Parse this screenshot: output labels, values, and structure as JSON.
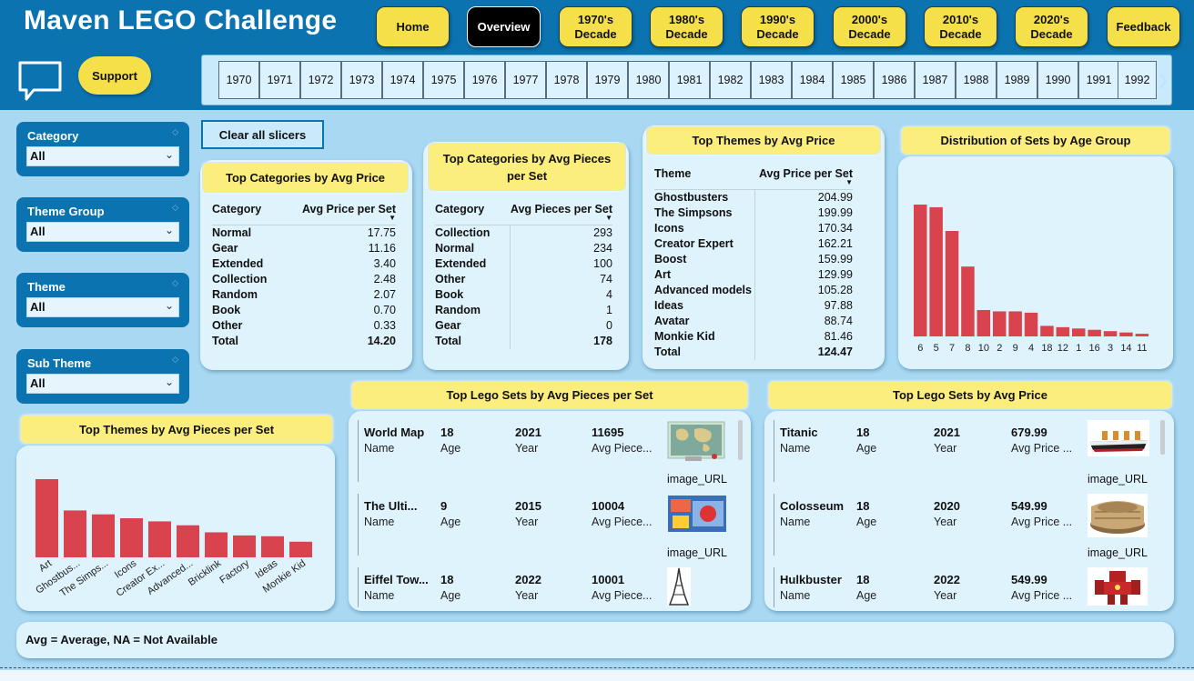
{
  "header": {
    "title": "Maven LEGO Challenge",
    "nav": [
      {
        "label": "Home",
        "active": false
      },
      {
        "label": "Overview",
        "active": true
      },
      {
        "label": "1970's Decade",
        "active": false
      },
      {
        "label": "1980's Decade",
        "active": false
      },
      {
        "label": "1990's Decade",
        "active": false
      },
      {
        "label": "2000's Decade",
        "active": false
      },
      {
        "label": "2010's Decade",
        "active": false
      },
      {
        "label": "2020's Decade",
        "active": false
      },
      {
        "label": "Feedback",
        "active": false
      }
    ],
    "support_label": "Support",
    "years": [
      "1970",
      "1971",
      "1972",
      "1973",
      "1974",
      "1975",
      "1976",
      "1977",
      "1978",
      "1979",
      "1980",
      "1981",
      "1982",
      "1983",
      "1984",
      "1985",
      "1986",
      "1987",
      "1988",
      "1989",
      "1990",
      "1991",
      "1992"
    ]
  },
  "slicers": [
    {
      "label": "Category",
      "value": "All"
    },
    {
      "label": "Theme Group",
      "value": "All"
    },
    {
      "label": "Theme",
      "value": "All"
    },
    {
      "label": "Sub Theme",
      "value": "All"
    }
  ],
  "clear_label": "Clear all slicers",
  "top_categories_price": {
    "title": "Top Categories by Avg Price",
    "col1": "Category",
    "col2": "Avg Price per Set",
    "rows": [
      [
        "Normal",
        "17.75"
      ],
      [
        "Gear",
        "11.16"
      ],
      [
        "Extended",
        "3.40"
      ],
      [
        "Collection",
        "2.48"
      ],
      [
        "Random",
        "2.07"
      ],
      [
        "Book",
        "0.70"
      ],
      [
        "Other",
        "0.33"
      ]
    ],
    "total_label": "Total",
    "total": "14.20"
  },
  "top_categories_pieces": {
    "title": "Top Categories by Avg Pieces per Set",
    "col1": "Category",
    "col2": "Avg Pieces per Set",
    "rows": [
      [
        "Collection",
        "293"
      ],
      [
        "Normal",
        "234"
      ],
      [
        "Extended",
        "100"
      ],
      [
        "Other",
        "74"
      ],
      [
        "Book",
        "4"
      ],
      [
        "Random",
        "1"
      ],
      [
        "Gear",
        "0"
      ]
    ],
    "total_label": "Total",
    "total": "178"
  },
  "top_themes_price": {
    "title": "Top Themes by Avg Price",
    "col1": "Theme",
    "col2": "Avg Price per Set",
    "rows": [
      [
        "Ghostbusters",
        "204.99"
      ],
      [
        "The Simpsons",
        "199.99"
      ],
      [
        "Icons",
        "170.34"
      ],
      [
        "Creator Expert",
        "162.21"
      ],
      [
        "Boost",
        "159.99"
      ],
      [
        "Art",
        "129.99"
      ],
      [
        "Advanced models",
        "105.28"
      ],
      [
        "Ideas",
        "97.88"
      ],
      [
        "Avatar",
        "88.74"
      ],
      [
        "Monkie Kid",
        "81.46"
      ]
    ],
    "total_label": "Total",
    "total": "124.47"
  },
  "age_distribution_title": "Distribution of Sets by Age Group",
  "themes_pieces_title": "Top Themes by Avg Pieces per Set",
  "sets_by_pieces": {
    "title": "Top Lego Sets by Avg Pieces per Set",
    "rows": [
      {
        "name": "World Map",
        "age": "18",
        "year": "2021",
        "metric": "11695"
      },
      {
        "name": "The Ulti...",
        "age": "9",
        "year": "2015",
        "metric": "10004"
      },
      {
        "name": "Eiffel Tow...",
        "age": "18",
        "year": "2022",
        "metric": "10001"
      }
    ],
    "labels": {
      "name": "Name",
      "age": "Age",
      "year": "Year",
      "metric": "Avg Piece...",
      "image": "image_URL"
    }
  },
  "sets_by_price": {
    "title": "Top Lego Sets by Avg Price",
    "rows": [
      {
        "name": "Titanic",
        "age": "18",
        "year": "2021",
        "metric": "679.99"
      },
      {
        "name": "Colosseum",
        "age": "18",
        "year": "2020",
        "metric": "549.99"
      },
      {
        "name": "Hulkbuster",
        "age": "18",
        "year": "2022",
        "metric": "549.99"
      }
    ],
    "labels": {
      "name": "Name",
      "age": "Age",
      "year": "Year",
      "metric": "Avg Price ...",
      "image": "image_URL"
    }
  },
  "note": "Avg = Average, NA = Not Available",
  "colors": {
    "header": "#0b73b0",
    "accent": "#f5e04a",
    "bar": "#d9434d",
    "background": "#a8d8f2",
    "card": "#dff3fd"
  },
  "icons": {
    "support": "chat-bubble-icon",
    "scroll": "chevron-right-icon",
    "dropdown": "chevron-down-icon"
  },
  "chart_data": [
    {
      "type": "bar",
      "categories": [
        "6",
        "5",
        "7",
        "8",
        "10",
        "2",
        "9",
        "4",
        "18",
        "12",
        "1",
        "16",
        "3",
        "14",
        "11"
      ],
      "values": [
        100,
        98,
        80,
        53,
        20,
        19,
        19,
        18,
        8,
        7,
        6,
        5,
        4,
        3,
        2
      ],
      "title": "Distribution of Sets by Age Group",
      "xlabel": "",
      "ylabel": "",
      "ylim": [
        0,
        100
      ]
    },
    {
      "type": "bar",
      "categories": [
        "Art",
        "Ghostbus...",
        "The Simps...",
        "Icons",
        "Creator Ex...",
        "Advanced...",
        "Bricklink",
        "Factory",
        "Ideas",
        "Monkie Kid"
      ],
      "values": [
        100,
        60,
        55,
        50,
        46,
        41,
        32,
        28,
        27,
        20
      ],
      "title": "Top Themes by Avg Pieces per Set",
      "xlabel": "",
      "ylabel": "",
      "ylim": [
        0,
        100
      ]
    }
  ]
}
